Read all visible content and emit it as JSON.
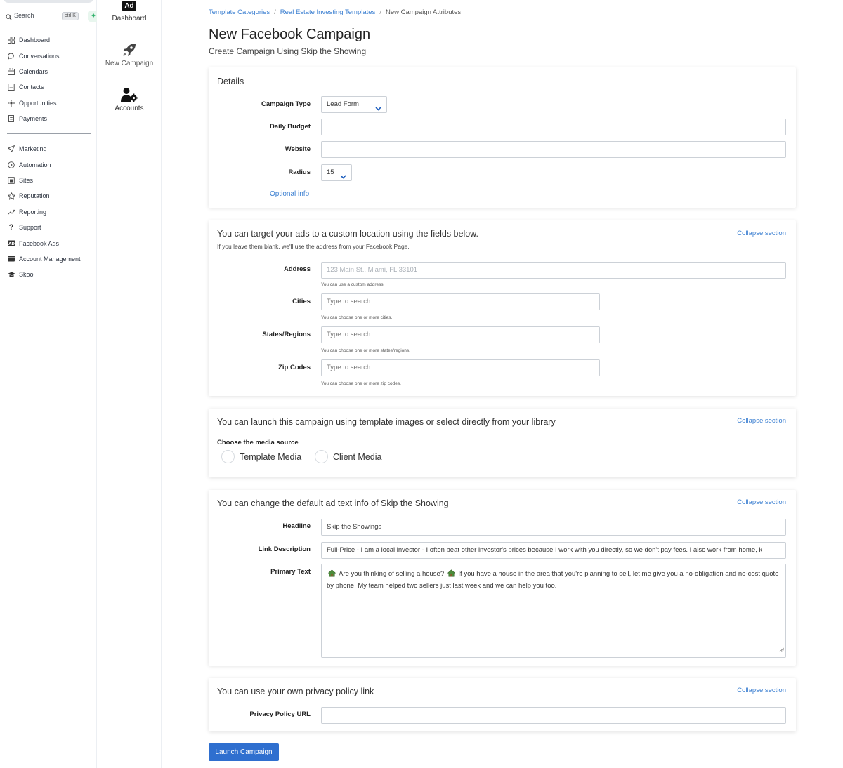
{
  "sidebar": {
    "search": {
      "label": "Search",
      "shortcut": "ctrl K"
    },
    "items": [
      {
        "label": "Dashboard",
        "icon": "dashboard-icon"
      },
      {
        "label": "Conversations",
        "icon": "chat-icon"
      },
      {
        "label": "Calendars",
        "icon": "calendar-icon"
      },
      {
        "label": "Contacts",
        "icon": "contacts-icon"
      },
      {
        "label": "Opportunities",
        "icon": "opportunities-icon"
      },
      {
        "label": "Payments",
        "icon": "payments-icon"
      }
    ],
    "items2": [
      {
        "label": "Marketing",
        "icon": "send-icon"
      },
      {
        "label": "Automation",
        "icon": "automation-icon"
      },
      {
        "label": "Sites",
        "icon": "sites-icon"
      },
      {
        "label": "Reputation",
        "icon": "star-icon"
      },
      {
        "label": "Reporting",
        "icon": "trend-icon"
      },
      {
        "label": "Support",
        "icon": "question-icon"
      },
      {
        "label": "Facebook Ads",
        "icon": "ad-icon"
      },
      {
        "label": "Account Management",
        "icon": "card-icon"
      },
      {
        "label": "Skool",
        "icon": "graduation-cap-icon"
      }
    ]
  },
  "appnav": {
    "ad_badge": "Ad",
    "dashboard": "Dashboard",
    "new_campaign": "New Campaign",
    "accounts": "Accounts"
  },
  "breadcrumb": {
    "item1": "Template Categories",
    "item2": "Real Estate Investing Templates",
    "current": "New Campaign Attributes"
  },
  "page": {
    "title": "New Facebook Campaign",
    "subtitle": "Create Campaign Using Skip the Showing"
  },
  "details": {
    "title": "Details",
    "campaign_type_label": "Campaign Type",
    "campaign_type_value": "Lead Form",
    "daily_budget_label": "Daily Budget",
    "daily_budget_value": "",
    "website_label": "Website",
    "website_value": "",
    "radius_label": "Radius",
    "radius_value": "15",
    "optional_link": "Optional info"
  },
  "location": {
    "title": "You can target your ads to a custom location using the fields below.",
    "note": "If you leave them blank, we'll use the address from your Facebook Page.",
    "collapse": "Collapse section",
    "address_label": "Address",
    "address_placeholder": "123 Main St., Miami, FL 33101",
    "address_help": "You can use a custom address.",
    "cities_label": "Cities",
    "cities_placeholder": "Type to search",
    "cities_help": "You can choose one or more cities.",
    "states_label": "States/Regions",
    "states_placeholder": "Type to search",
    "states_help": "You can choose one or more states/regions.",
    "zip_label": "Zip Codes",
    "zip_placeholder": "Type to search",
    "zip_help": "You can choose one or more zip codes."
  },
  "media": {
    "title": "You can launch this campaign using template images or select directly from your library",
    "collapse": "Collapse section",
    "source_label": "Choose the media source",
    "option1": "Template Media",
    "option2": "Client Media"
  },
  "adtext": {
    "title": "You can change the default ad text info of Skip the Showing",
    "collapse": "Collapse section",
    "headline_label": "Headline",
    "headline_value": "Skip the Showings",
    "link_desc_label": "Link Description",
    "link_desc_value": "Full-Price - I am a local investor - I often beat other investor's prices because I work with you directly, so we don't pay fees. I also work from home, k",
    "primary_label": "Primary Text",
    "primary_part1": "Are you thinking of selling a house?",
    "primary_part2": "If you have a house in the area that you're planning to sell, let me give you a no-obligation and no-cost quote by phone. My team helped two sellers just last week and we can help you too."
  },
  "privacy": {
    "title": "You can use your own privacy policy link",
    "collapse": "Collapse section",
    "url_label": "Privacy Policy URL",
    "url_value": ""
  },
  "launch_button": "Launch Campaign"
}
